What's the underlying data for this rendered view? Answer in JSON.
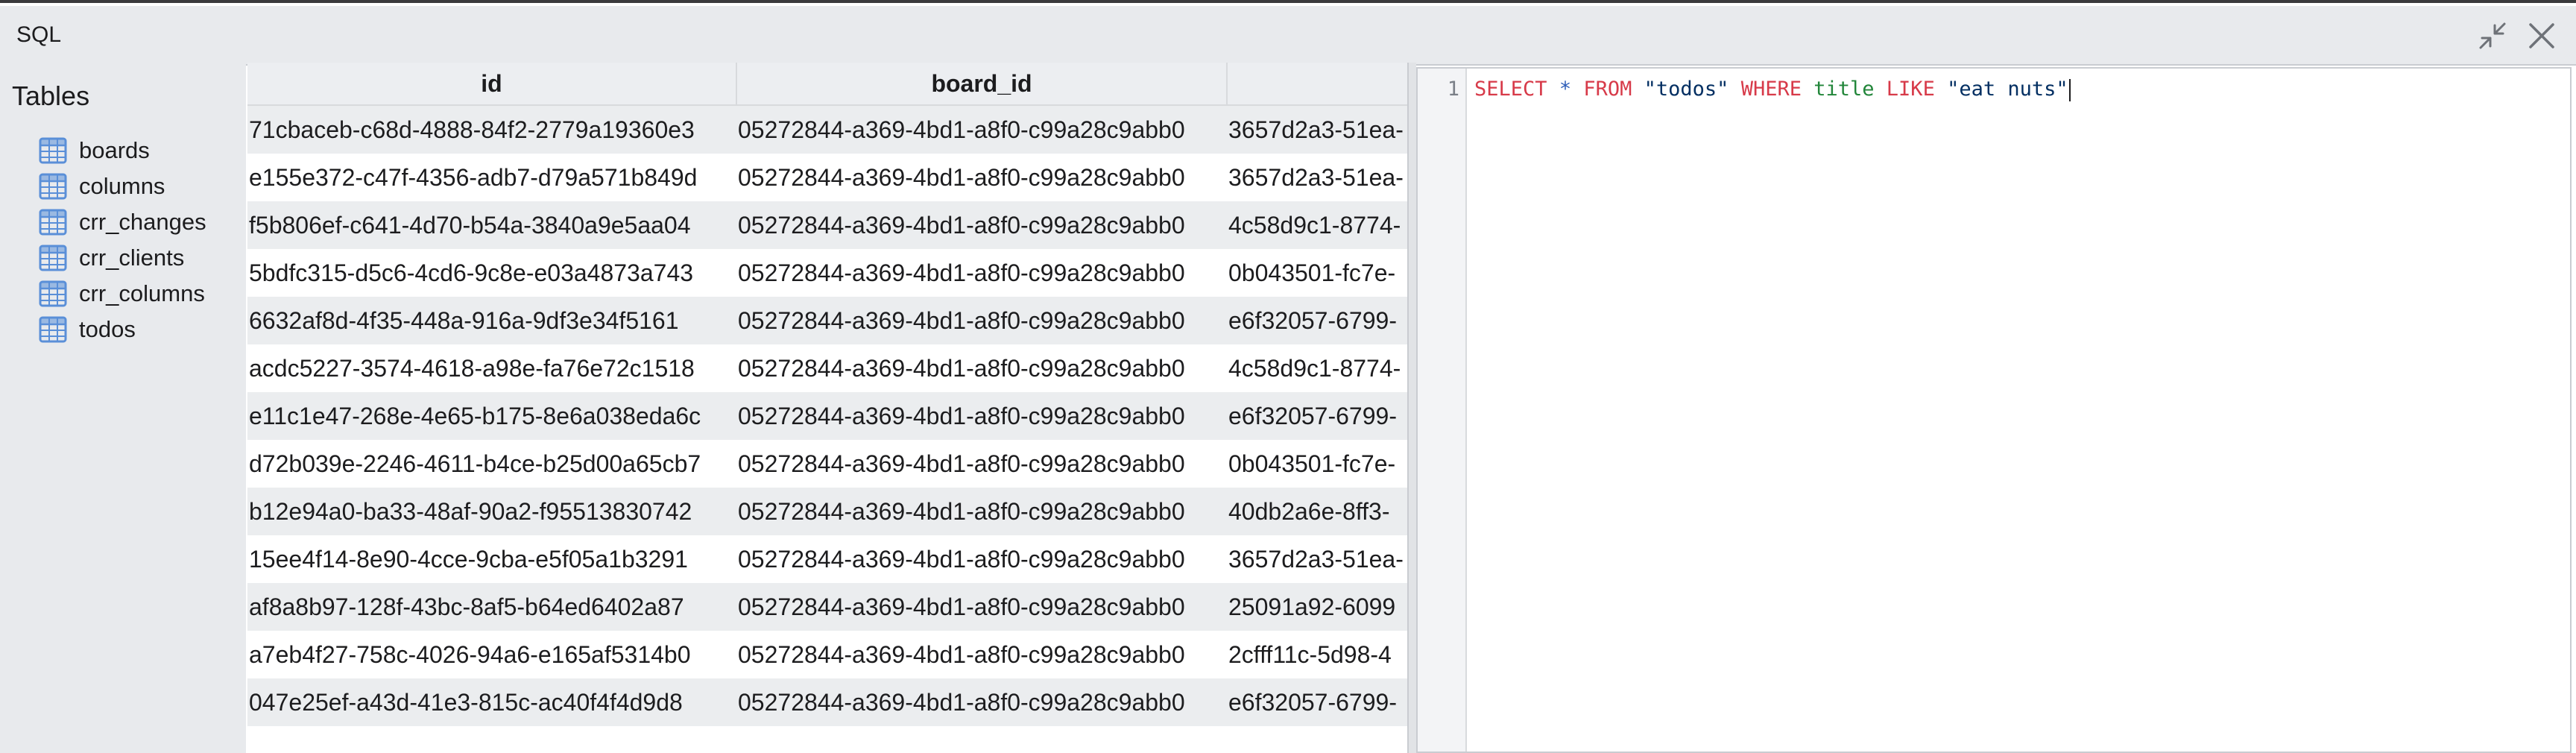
{
  "window": {
    "title": "SQL"
  },
  "sidebar": {
    "heading": "Tables",
    "tables": [
      {
        "label": "boards"
      },
      {
        "label": "columns"
      },
      {
        "label": "crr_changes"
      },
      {
        "label": "crr_clients"
      },
      {
        "label": "crr_columns"
      },
      {
        "label": "todos"
      }
    ]
  },
  "results": {
    "columns": [
      "id",
      "board_id",
      ""
    ],
    "rows": [
      [
        "71cbaceb-c68d-4888-84f2-2779a19360e3",
        "05272844-a369-4bd1-a8f0-c99a28c9abb0",
        "3657d2a3-51ea-"
      ],
      [
        "e155e372-c47f-4356-adb7-d79a571b849d",
        "05272844-a369-4bd1-a8f0-c99a28c9abb0",
        "3657d2a3-51ea-"
      ],
      [
        "f5b806ef-c641-4d70-b54a-3840a9e5aa04",
        "05272844-a369-4bd1-a8f0-c99a28c9abb0",
        "4c58d9c1-8774-"
      ],
      [
        "5bdfc315-d5c6-4cd6-9c8e-e03a4873a743",
        "05272844-a369-4bd1-a8f0-c99a28c9abb0",
        "0b043501-fc7e-"
      ],
      [
        "6632af8d-4f35-448a-916a-9df3e34f5161",
        "05272844-a369-4bd1-a8f0-c99a28c9abb0",
        "e6f32057-6799-"
      ],
      [
        "acdc5227-3574-4618-a98e-fa76e72c1518",
        "05272844-a369-4bd1-a8f0-c99a28c9abb0",
        "4c58d9c1-8774-"
      ],
      [
        "e11c1e47-268e-4e65-b175-8e6a038eda6c",
        "05272844-a369-4bd1-a8f0-c99a28c9abb0",
        "e6f32057-6799-"
      ],
      [
        "d72b039e-2246-4611-b4ce-b25d00a65cb7",
        "05272844-a369-4bd1-a8f0-c99a28c9abb0",
        "0b043501-fc7e-"
      ],
      [
        "b12e94a0-ba33-48af-90a2-f95513830742",
        "05272844-a369-4bd1-a8f0-c99a28c9abb0",
        "40db2a6e-8ff3-"
      ],
      [
        "15ee4f14-8e90-4cce-9cba-e5f05a1b3291",
        "05272844-a369-4bd1-a8f0-c99a28c9abb0",
        "3657d2a3-51ea-"
      ],
      [
        "af8a8b97-128f-43bc-8af5-b64ed6402a87",
        "05272844-a369-4bd1-a8f0-c99a28c9abb0",
        "25091a92-6099"
      ],
      [
        "a7eb4f27-758c-4026-94a6-e165af5314b0",
        "05272844-a369-4bd1-a8f0-c99a28c9abb0",
        "2cfff11c-5d98-4"
      ],
      [
        "047e25ef-a43d-41e3-815c-ac40f4f4d9d8",
        "05272844-a369-4bd1-a8f0-c99a28c9abb0",
        "e6f32057-6799-"
      ]
    ]
  },
  "editor": {
    "line_number": "1",
    "tokens": [
      {
        "text": "SELECT",
        "kind": "kw"
      },
      {
        "text": " ",
        "kind": "plain"
      },
      {
        "text": "*",
        "kind": "op"
      },
      {
        "text": " ",
        "kind": "plain"
      },
      {
        "text": "FROM",
        "kind": "kw"
      },
      {
        "text": " ",
        "kind": "plain"
      },
      {
        "text": "\"todos\"",
        "kind": "str"
      },
      {
        "text": " ",
        "kind": "plain"
      },
      {
        "text": "WHERE",
        "kind": "kw"
      },
      {
        "text": " ",
        "kind": "plain"
      },
      {
        "text": "title",
        "kind": "ident"
      },
      {
        "text": " ",
        "kind": "plain"
      },
      {
        "text": "LIKE",
        "kind": "kw"
      },
      {
        "text": " ",
        "kind": "plain"
      },
      {
        "text": "\"eat nuts\"",
        "kind": "str"
      }
    ]
  },
  "icons": {
    "minimize": "collapse-arrows-icon",
    "close": "close-icon",
    "table": "table-grid-icon"
  },
  "colors": {
    "table_icon": "#5a8fd8",
    "keyword": "#d73a49",
    "string": "#032f62",
    "identifier": "#22863a"
  }
}
